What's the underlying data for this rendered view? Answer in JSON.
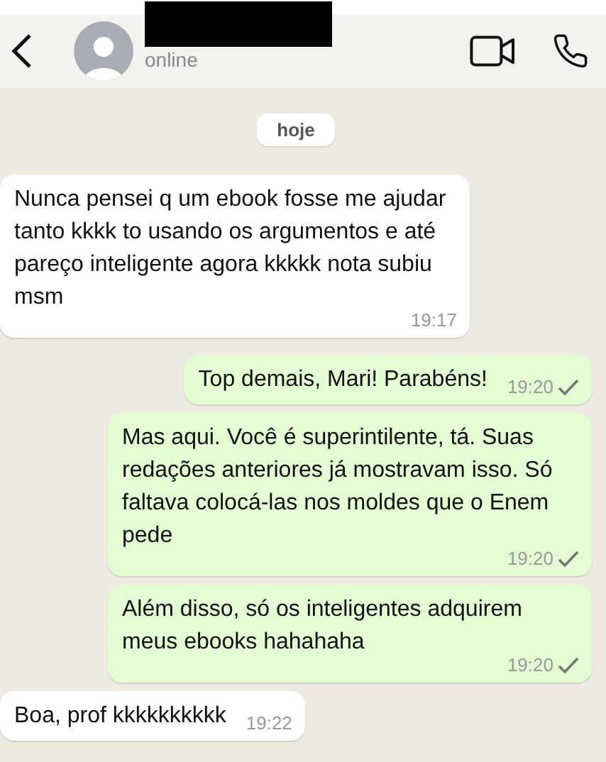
{
  "header": {
    "status": "online",
    "redacted_name": true
  },
  "date_chip": "hoje",
  "messages": [
    {
      "kind": "in",
      "text": "Nunca pensei q um ebook fosse me ajudar tanto kkkk to usando os argumentos e até pareço inteligente agora kkkkk nota subiu msm",
      "time": "19:17"
    },
    {
      "kind": "out",
      "text": "Top demais, Mari! Parabéns!",
      "time": "19:20",
      "delivered": true
    },
    {
      "kind": "out",
      "text": "Mas aqui. Você é superintilente, tá. Suas redações anteriores já mostravam isso. Só faltava colocá-las nos moldes que o Enem pede",
      "time": "19:20",
      "delivered": true
    },
    {
      "kind": "out",
      "text": "Além disso, só os inteligentes adquirem meus ebooks hahahaha",
      "time": "19:20",
      "delivered": true
    },
    {
      "kind": "in",
      "text": "Boa, prof kkkkkkkkkk",
      "time": "19:22"
    }
  ]
}
